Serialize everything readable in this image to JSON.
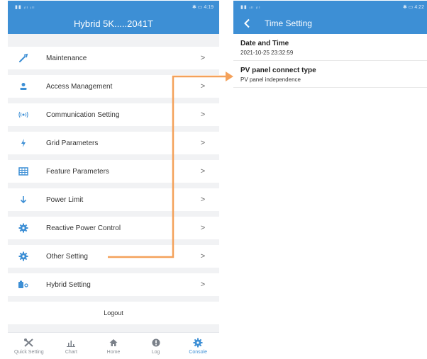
{
  "colors": {
    "primary": "#3d8fd5",
    "arrow": "#f4a15a",
    "background": "#f1f2f4"
  },
  "left_phone": {
    "status": {
      "left": "▮▮ ᵢₗₗ ᵢₗₗ",
      "right": "✱ ▭ 4:19"
    },
    "title": "Hybrid 5K.....2041T",
    "menu": [
      {
        "label": "Maintenance",
        "icon": "wrench-icon"
      },
      {
        "label": "Access Management",
        "icon": "user-icon"
      },
      {
        "label": "Communication Setting",
        "icon": "signal-icon"
      },
      {
        "label": "Grid Parameters",
        "icon": "lightning-icon"
      },
      {
        "label": "Feature Parameters",
        "icon": "grid-icon"
      },
      {
        "label": "Power Limit",
        "icon": "arrow-down-icon"
      },
      {
        "label": "Reactive Power Control",
        "icon": "gear-icon"
      },
      {
        "label": "Other Setting",
        "icon": "gear-icon"
      },
      {
        "label": "Hybrid Setting",
        "icon": "battery-icon"
      }
    ],
    "logout": "Logout",
    "tabs": [
      {
        "label": "Quick Setting",
        "icon": "tools-icon"
      },
      {
        "label": "Chart",
        "icon": "chart-icon"
      },
      {
        "label": "Home",
        "icon": "home-icon"
      },
      {
        "label": "Log",
        "icon": "log-icon"
      },
      {
        "label": "Console",
        "icon": "gear-icon"
      }
    ],
    "active_tab": "Console"
  },
  "right_phone": {
    "status": {
      "left": "▮▮ ᵢₗₗ ᵢₗₗ",
      "right": "✱ ▭ 4:22"
    },
    "title": "Time Setting",
    "settings": [
      {
        "title": "Date and Time",
        "value": "2021-10-25 23:32:59"
      },
      {
        "title": "PV panel connect type",
        "value": "PV panel independence"
      }
    ]
  }
}
